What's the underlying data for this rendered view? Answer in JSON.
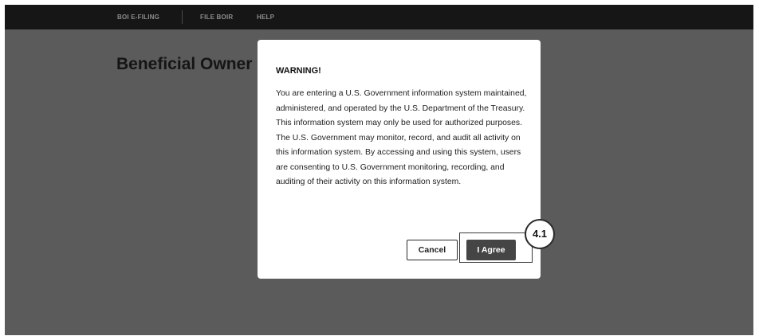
{
  "nav": {
    "items": [
      {
        "label": "BOI E-FILING"
      },
      {
        "label": "FILE BOIR"
      },
      {
        "label": "HELP"
      }
    ]
  },
  "page": {
    "title": "Beneficial Owner"
  },
  "modal": {
    "title": "WARNING!",
    "body": "You are entering a U.S. Government information system maintained, administered, and operated by the U.S. Department of the Treasury. This information system may only be used for authorized purposes. The U.S. Government may monitor, record, and audit all activity on this information system. By accessing and using this system, users are consenting to U.S. Government monitoring, recording, and auditing of their activity on this information system.",
    "cancel_label": "Cancel",
    "agree_label": "I Agree"
  },
  "annotation": {
    "label": "4.1"
  },
  "colors": {
    "overlay": "#5b5b5b",
    "nav_background": "#161616",
    "agree_button": "#454545"
  }
}
